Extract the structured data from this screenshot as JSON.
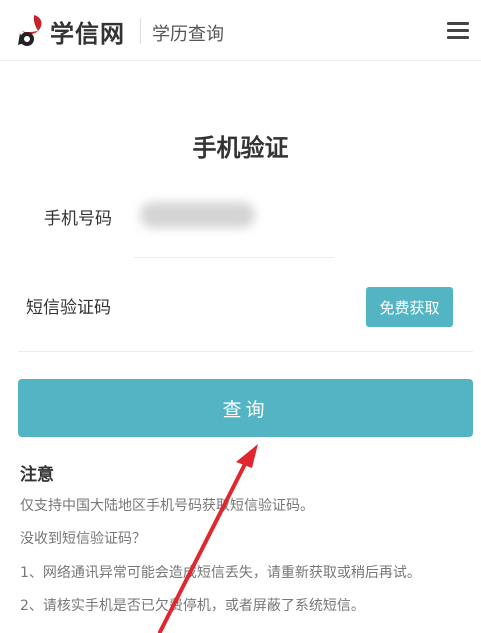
{
  "header": {
    "logo_text": "学信网",
    "subtitle": "学历查询",
    "menu_icon": "hamburger-menu-icon"
  },
  "page": {
    "title": "手机验证"
  },
  "form": {
    "phone_label": "手机号码",
    "phone_value": "",
    "sms_label": "短信验证码",
    "sms_value": "",
    "get_code_button": "免费获取",
    "submit_button": "查询"
  },
  "notice": {
    "title": "注意",
    "lines": [
      "仅支持中国大陆地区手机号码获取短信验证码。",
      "没收到短信验证码？",
      "1、网络通讯异常可能会造成短信丢失，请重新获取或稍后再试。",
      "2、请核实手机是否已欠费停机，或者屏蔽了系统短信。"
    ]
  },
  "colors": {
    "accent": "#53b5c4",
    "logo_red": "#c8232c",
    "annotation_arrow": "#e0262e"
  }
}
